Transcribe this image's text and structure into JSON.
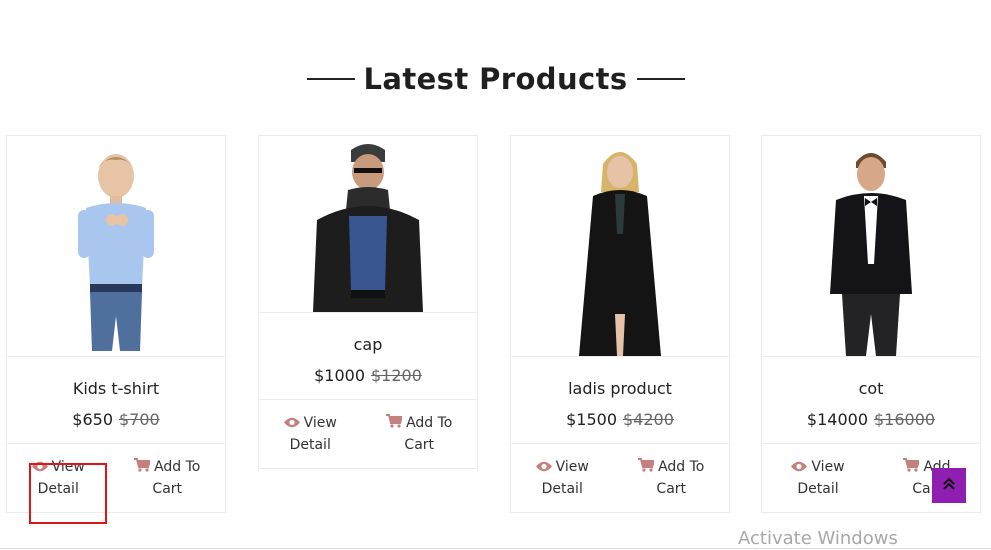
{
  "section": {
    "title": "Latest Products"
  },
  "products": [
    {
      "name": "Kids t-shirt",
      "price": "$650",
      "old_price": "$700",
      "view_label": "View\nDetail",
      "cart_label": "Add To\nCart"
    },
    {
      "name": "cap",
      "price": "$1000",
      "old_price": "$1200",
      "view_label": "View\nDetail",
      "cart_label": "Add To\nCart"
    },
    {
      "name": "ladis product",
      "price": "$1500",
      "old_price": "$4200",
      "view_label": "View\nDetail",
      "cart_label": "Add To\nCart"
    },
    {
      "name": "cot",
      "price": "$14000",
      "old_price": "$16000",
      "view_label": "View\nDetail",
      "cart_label": "Add\nCart"
    }
  ],
  "icons": {
    "view": "eye-icon",
    "cart": "cart-icon",
    "scroll": "chevron-double-up-icon"
  },
  "colors": {
    "icon_accent": "#c47f7f",
    "scroll_button": "#8f1fb0",
    "highlight": "#e01616"
  },
  "watermark": "Activate Windows"
}
